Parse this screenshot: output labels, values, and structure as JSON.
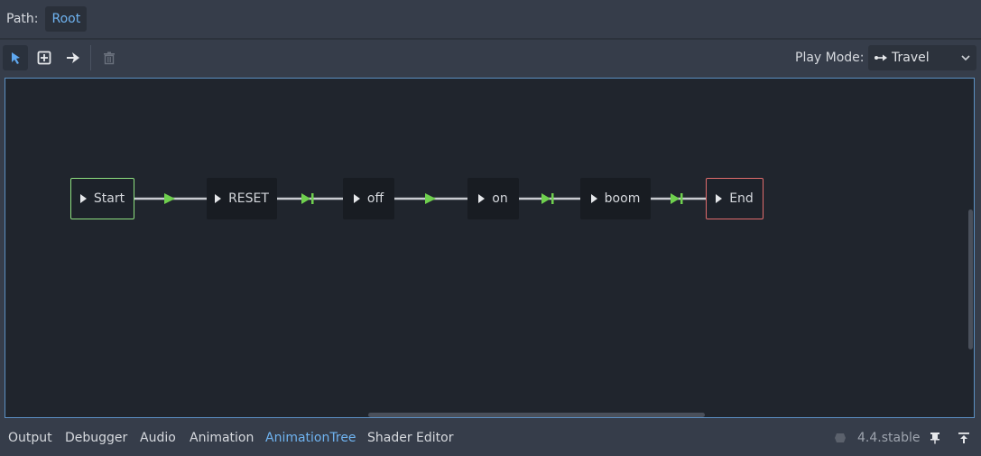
{
  "path": {
    "label": "Path:",
    "root": "Root"
  },
  "toolbar": {
    "tools": [
      "select-tool",
      "add-node-tool",
      "connect-tool",
      "delete-tool"
    ],
    "play_mode_label": "Play Mode:",
    "play_mode_value": "Travel"
  },
  "graph": {
    "nodes": [
      {
        "id": "start",
        "label": "Start",
        "kind": "start"
      },
      {
        "id": "reset",
        "label": "RESET",
        "kind": "state"
      },
      {
        "id": "off",
        "label": "off",
        "kind": "state"
      },
      {
        "id": "on",
        "label": "on",
        "kind": "state"
      },
      {
        "id": "boom",
        "label": "boom",
        "kind": "state"
      },
      {
        "id": "end",
        "label": "End",
        "kind": "end"
      }
    ],
    "transitions": [
      {
        "from": "Start",
        "to": "RESET",
        "type": "immediate"
      },
      {
        "from": "RESET",
        "to": "off",
        "type": "at-end"
      },
      {
        "from": "off",
        "to": "on",
        "type": "immediate"
      },
      {
        "from": "on",
        "to": "boom",
        "type": "at-end"
      },
      {
        "from": "boom",
        "to": "End",
        "type": "at-end"
      }
    ],
    "colors": {
      "transition": "#6fd04e",
      "start_border": "#8ee07f",
      "end_border": "#e06c6c"
    }
  },
  "bottom": {
    "tabs": [
      "Output",
      "Debugger",
      "Audio",
      "Animation",
      "AnimationTree",
      "Shader Editor"
    ],
    "active_tab": "AnimationTree",
    "version": "4.4.stable"
  },
  "colors": {
    "accent": "#6fb3f0",
    "background": "#363d4a",
    "graph_background": "#20252d"
  }
}
